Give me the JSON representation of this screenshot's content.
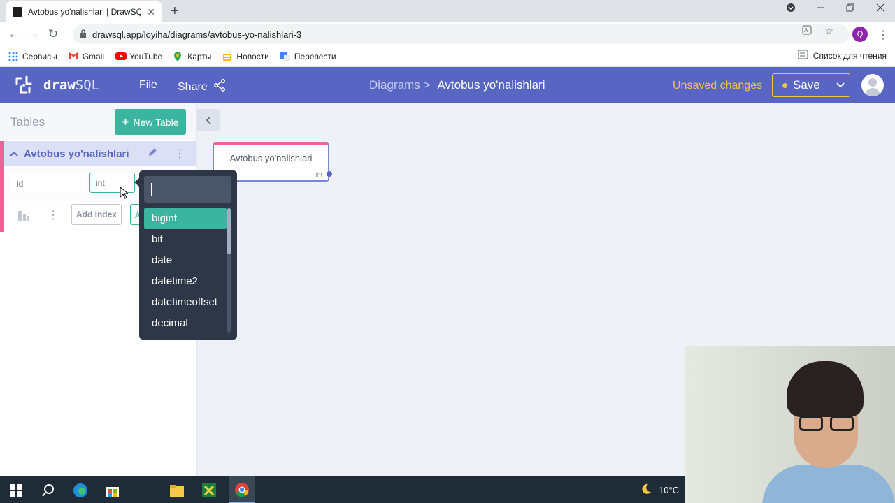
{
  "browser": {
    "tab_title": "Avtobus yo'nalishlari | DrawSQL",
    "tab_close": "✕",
    "new_tab": "+",
    "url": "drawsql.app/loyiha/diagrams/avtobus-yo-nalishlari-3",
    "profile_initial": "Q",
    "bookmarks": [
      {
        "label": "Сервисы",
        "color": "#4285f4"
      },
      {
        "label": "Gmail",
        "color": "#ea4335"
      },
      {
        "label": "YouTube",
        "color": "#ff0000"
      },
      {
        "label": "Карты",
        "color": "#34a853"
      },
      {
        "label": "Новости",
        "color": "#5f6368"
      },
      {
        "label": "Перевести",
        "color": "#4285f4"
      }
    ],
    "reading_list": "Список для чтения"
  },
  "app": {
    "logo_prefix": "draw",
    "logo_suffix": "SQL",
    "menu_file": "File",
    "menu_share": "Share",
    "breadcrumb_parent": "Diagrams >",
    "breadcrumb_current": "Avtobus yo'nalishlari",
    "unsaved": "Unsaved changes",
    "save": "Save",
    "accent": "#5865c2",
    "teal": "#3cb5a0",
    "pink": "#ec6395",
    "warning": "#f6c344"
  },
  "sidebar": {
    "title": "Tables",
    "new_table": "New Table",
    "table_name": "Avtobus yo'nalishlari",
    "column": {
      "name": "id",
      "type": "int"
    },
    "add_index": "Add Index",
    "add_more_partial": "A"
  },
  "canvas": {
    "entity_name": "Avtobus yo'nalishlari",
    "entity_type": "int"
  },
  "type_dropdown": {
    "search_value": "",
    "options": [
      "bigint",
      "bit",
      "date",
      "datetime2",
      "datetimeoffset",
      "decimal"
    ],
    "selected": "bigint"
  },
  "taskbar": {
    "weather": "10°C"
  }
}
